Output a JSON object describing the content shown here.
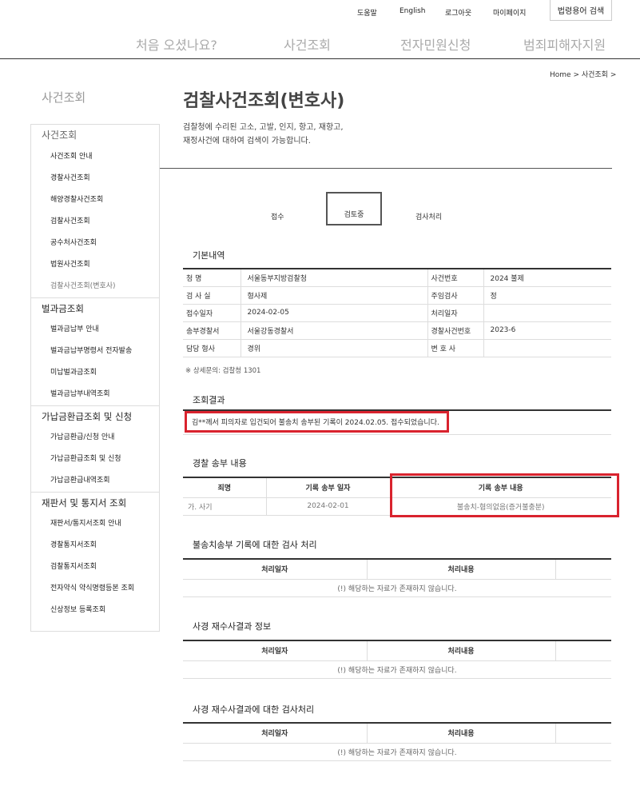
{
  "utility": {
    "help": "도움말",
    "english": "English",
    "logout": "로그아웃",
    "mypage": "마이페이지",
    "law_search": "법령용어 검색"
  },
  "gnb": {
    "items": [
      "처음 오셨나요?",
      "사건조회",
      "전자민원신청",
      "범죄피해자지원"
    ]
  },
  "breadcrumb": "Home > 사건조회 >",
  "lnb": {
    "title": "사건조회",
    "groups": [
      {
        "label": "사건조회",
        "items": [
          "사건조회 안내",
          "경찰사건조회",
          "해양경찰사건조회",
          "검찰사건조회",
          "공수처사건조회",
          "법원사건조회",
          "검찰사건조회(변호사)"
        ]
      },
      {
        "label": "벌과금조회",
        "items": [
          "벌과금납부 안내",
          "벌과금납부명령서 전자발송",
          "미납벌과금조회",
          "벌과금납부내역조회"
        ]
      },
      {
        "label": "가납금환급조회 및 신청",
        "items": [
          "가납금환급/신청 안내",
          "가납금환급조회 및 신청",
          "가납금환급내역조회"
        ]
      },
      {
        "label": "재판서 및 통지서 조회",
        "items": [
          "재판서/통지서조회 안내",
          "경찰통지서조회",
          "검찰통지서조회",
          "전자약식 약식명령등본 조회",
          "신상정보 등록조회"
        ]
      }
    ]
  },
  "main": {
    "title": "검찰사건조회(변호사)",
    "desc_line1": "검찰청에 수리된 고소, 고발, 인지, 항고, 재항고,",
    "desc_line2": "재정사건에 대하여 검색이 가능합니다.",
    "steps": [
      "접수",
      "검토중",
      "검사처리"
    ],
    "basic_title": "기본내역",
    "basic_rows": [
      {
        "l1": "청      명",
        "v1": "서울동부지방검찰청",
        "l2": "사건번호",
        "v2": "2024 불제"
      },
      {
        "l1": "검 사 실",
        "v1": "형사제",
        "l2": "주임검사",
        "v2": "정"
      },
      {
        "l1": "접수일자",
        "v1": "2024-02-05",
        "l2": "처리일자",
        "v2": ""
      },
      {
        "l1": "송부경찰서",
        "v1": "서울강동경찰서",
        "l2": "경찰사건번호",
        "v2": "2023-6"
      },
      {
        "l1": "담당 형사",
        "v1": "경위",
        "l2": "변 호 사",
        "v2": ""
      }
    ],
    "note": "※ 상세문의: 검찰청 1301",
    "result_title": "조회결과",
    "result_text": "김**께서 피의자로 입건되어 불송치 송부된 기록이 2024.02.05. 접수되었습니다.",
    "police_title": "경찰 송부 내용",
    "police_headers": [
      "죄명",
      "기록 송부 일자",
      "기록 송부 내용"
    ],
    "police_row": [
      "가. 사기",
      "2024-02-01",
      "불송치-혐의없음(증거불충분)"
    ],
    "section3_title": "불송치송부 기록에 대한 검사 처리",
    "section4_title": "사경 재수사결과 정보",
    "section5_title": "사경 재수사결과에 대한 검사처리",
    "proc_headers": [
      "처리일자",
      "처리내용"
    ],
    "empty_msg": "(!) 해당하는 자료가 존재하지 않습니다."
  },
  "colors": {
    "highlight": "#d9232e",
    "rule": "#333333"
  }
}
